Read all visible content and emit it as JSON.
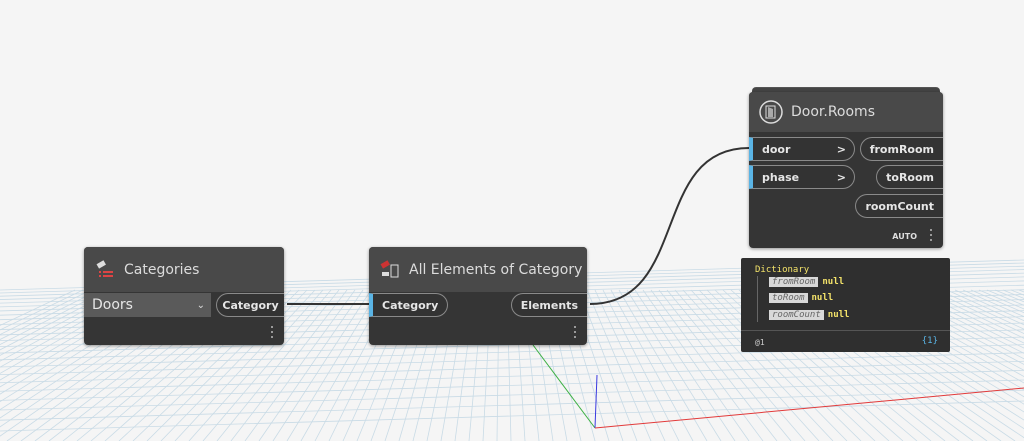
{
  "nodes": {
    "categories": {
      "title": "Categories",
      "dropdown_value": "Doors",
      "output": "Category"
    },
    "all_elements": {
      "title": "All Elements of Category",
      "input": "Category",
      "output": "Elements"
    },
    "door_rooms": {
      "title": "Door.Rooms",
      "inputs": [
        "door",
        "phase"
      ],
      "input_arrow": ">",
      "outputs": [
        "fromRoom",
        "toRoom",
        "roomCount"
      ],
      "lacing": "AUTO"
    }
  },
  "preview": {
    "type": "Dictionary",
    "entries": [
      {
        "key": "fromRoom",
        "value": "null"
      },
      {
        "key": "toRoom",
        "value": "null"
      },
      {
        "key": "roomCount",
        "value": "null"
      }
    ],
    "level": "@1",
    "count": "{1}"
  },
  "colors": {
    "port_accent": "#5ab4e5",
    "node_body": "#353535",
    "node_header": "#494949"
  }
}
